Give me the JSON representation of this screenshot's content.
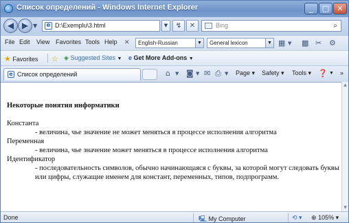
{
  "window": {
    "title": "Список определений - Windows Internet Explorer"
  },
  "address_bar": {
    "url": "D:\\Exemplu\\3.html",
    "search_placeholder": "Bing"
  },
  "menu": {
    "items": [
      "File",
      "Edit",
      "View",
      "Favorites",
      "Tools",
      "Help"
    ],
    "translator_language": "English-Russian",
    "translator_dictionary": "General lexicon"
  },
  "favorites_bar": {
    "favorites_label": "Favorites",
    "suggested_sites": "Suggested Sites",
    "addons": "Get More Add-ons"
  },
  "tab": {
    "label": "Список определений",
    "commands": [
      "Page",
      "Safety",
      "Tools"
    ]
  },
  "document": {
    "heading": "Некоторые понятия информатики",
    "definitions": [
      {
        "term": "Константа",
        "definition": "- величина, чье значение не может меняться в процессе исполнения алгоритма"
      },
      {
        "term": "Переменная",
        "definition": "- величина, чье значение может меняться в процессе исполнения алгоритма"
      },
      {
        "term": "Идентификатор",
        "definition": "- последовательность символов, обычно начинающаяся с буквы, за которой могут следовать буквы или цифры, служащие именем для констант, переменных, типов, подпрограмм."
      }
    ]
  },
  "status_bar": {
    "status": "Done",
    "zone": "My Computer",
    "zoom": "105%"
  }
}
